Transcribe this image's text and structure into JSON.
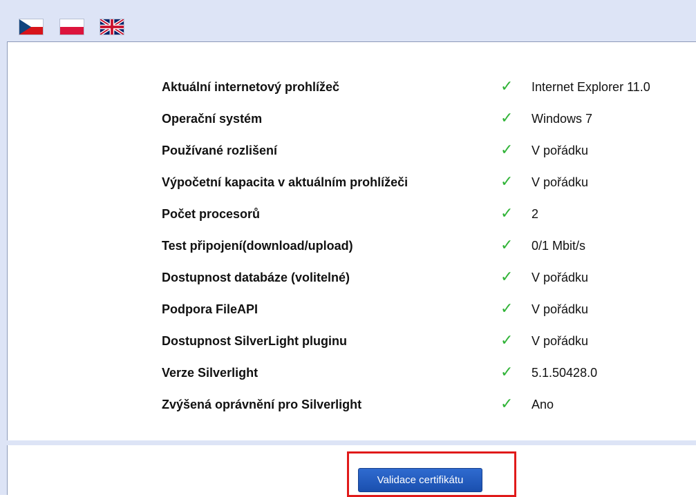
{
  "languages": [
    {
      "name": "czech-flag-icon"
    },
    {
      "name": "polish-flag-icon"
    },
    {
      "name": "uk-flag-icon"
    }
  ],
  "checks": [
    {
      "label": "Aktuální internetový prohlížeč",
      "value": "Internet Explorer 11.0",
      "status": "ok"
    },
    {
      "label": "Operační systém",
      "value": "Windows 7",
      "status": "ok"
    },
    {
      "label": "Používané rozlišení",
      "value": "V pořádku",
      "status": "ok"
    },
    {
      "label": "Výpočetní kapacita v aktuálním prohlížeči",
      "value": "V pořádku",
      "status": "ok"
    },
    {
      "label": "Počet procesorů",
      "value": "2",
      "status": "ok"
    },
    {
      "label": "Test připojení(download/upload)",
      "value": "0/1 Mbit/s",
      "status": "ok"
    },
    {
      "label": "Dostupnost databáze (volitelné)",
      "value": "V pořádku",
      "status": "ok"
    },
    {
      "label": "Podpora FileAPI",
      "value": "V pořádku",
      "status": "ok"
    },
    {
      "label": "Dostupnost SilverLight pluginu",
      "value": "V pořádku",
      "status": "ok"
    },
    {
      "label": "Verze Silverlight",
      "value": "5.1.50428.0",
      "status": "ok"
    },
    {
      "label": "Zvýšená oprávnění pro Silverlight",
      "value": "Ano",
      "status": "ok"
    }
  ],
  "check_mark": "✓",
  "validate_button_label": "Validace certifikátu",
  "colors": {
    "background": "#dde4f6",
    "check": "#2fb336",
    "button": "#1a4fae",
    "highlight": "#e01a1a"
  }
}
